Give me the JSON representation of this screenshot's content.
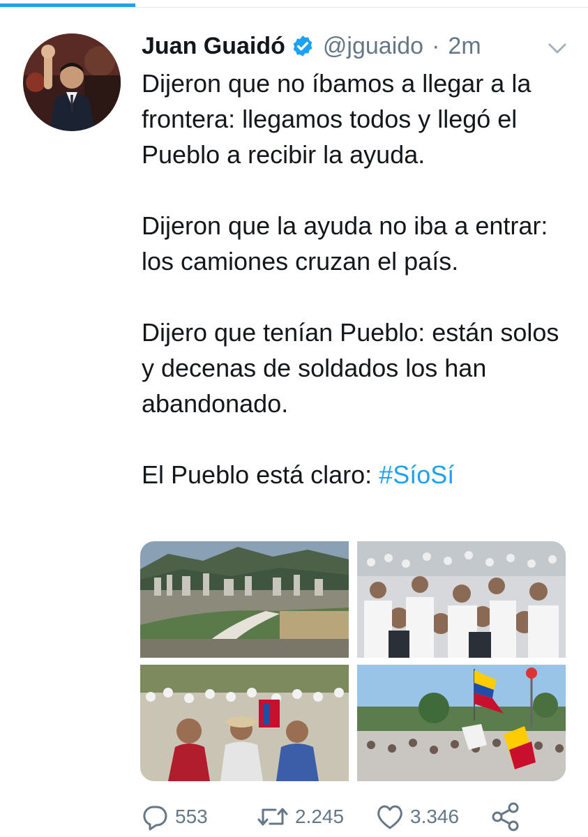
{
  "tweet": {
    "author_name": "Juan Guaidó",
    "handle": "@jguaido",
    "separator": "·",
    "time": "2m",
    "paragraphs": [
      "Dijeron que no íbamos a llegar a la frontera: llegamos todos y llegó el Pueblo a recibir la ayuda.",
      "Dijeron que la ayuda no iba a entrar: los camiones cruzan el país.",
      "Dijero que tenían Pueblo: están solos y decenas de soldados los han abandonado."
    ],
    "last_line_text": "El Pueblo está claro: ",
    "hashtag": "#SíoSí"
  },
  "actions": {
    "reply_count": "553",
    "retweet_count": "2.245",
    "like_count": "3.346"
  },
  "icons": {
    "verified": "verified-badge-icon",
    "menu": "chevron-down-icon",
    "reply": "reply-icon",
    "retweet": "retweet-icon",
    "like": "heart-icon",
    "share": "share-icon"
  },
  "colors": {
    "accent": "#1da1f2",
    "text": "#14171a",
    "muted": "#657786"
  }
}
